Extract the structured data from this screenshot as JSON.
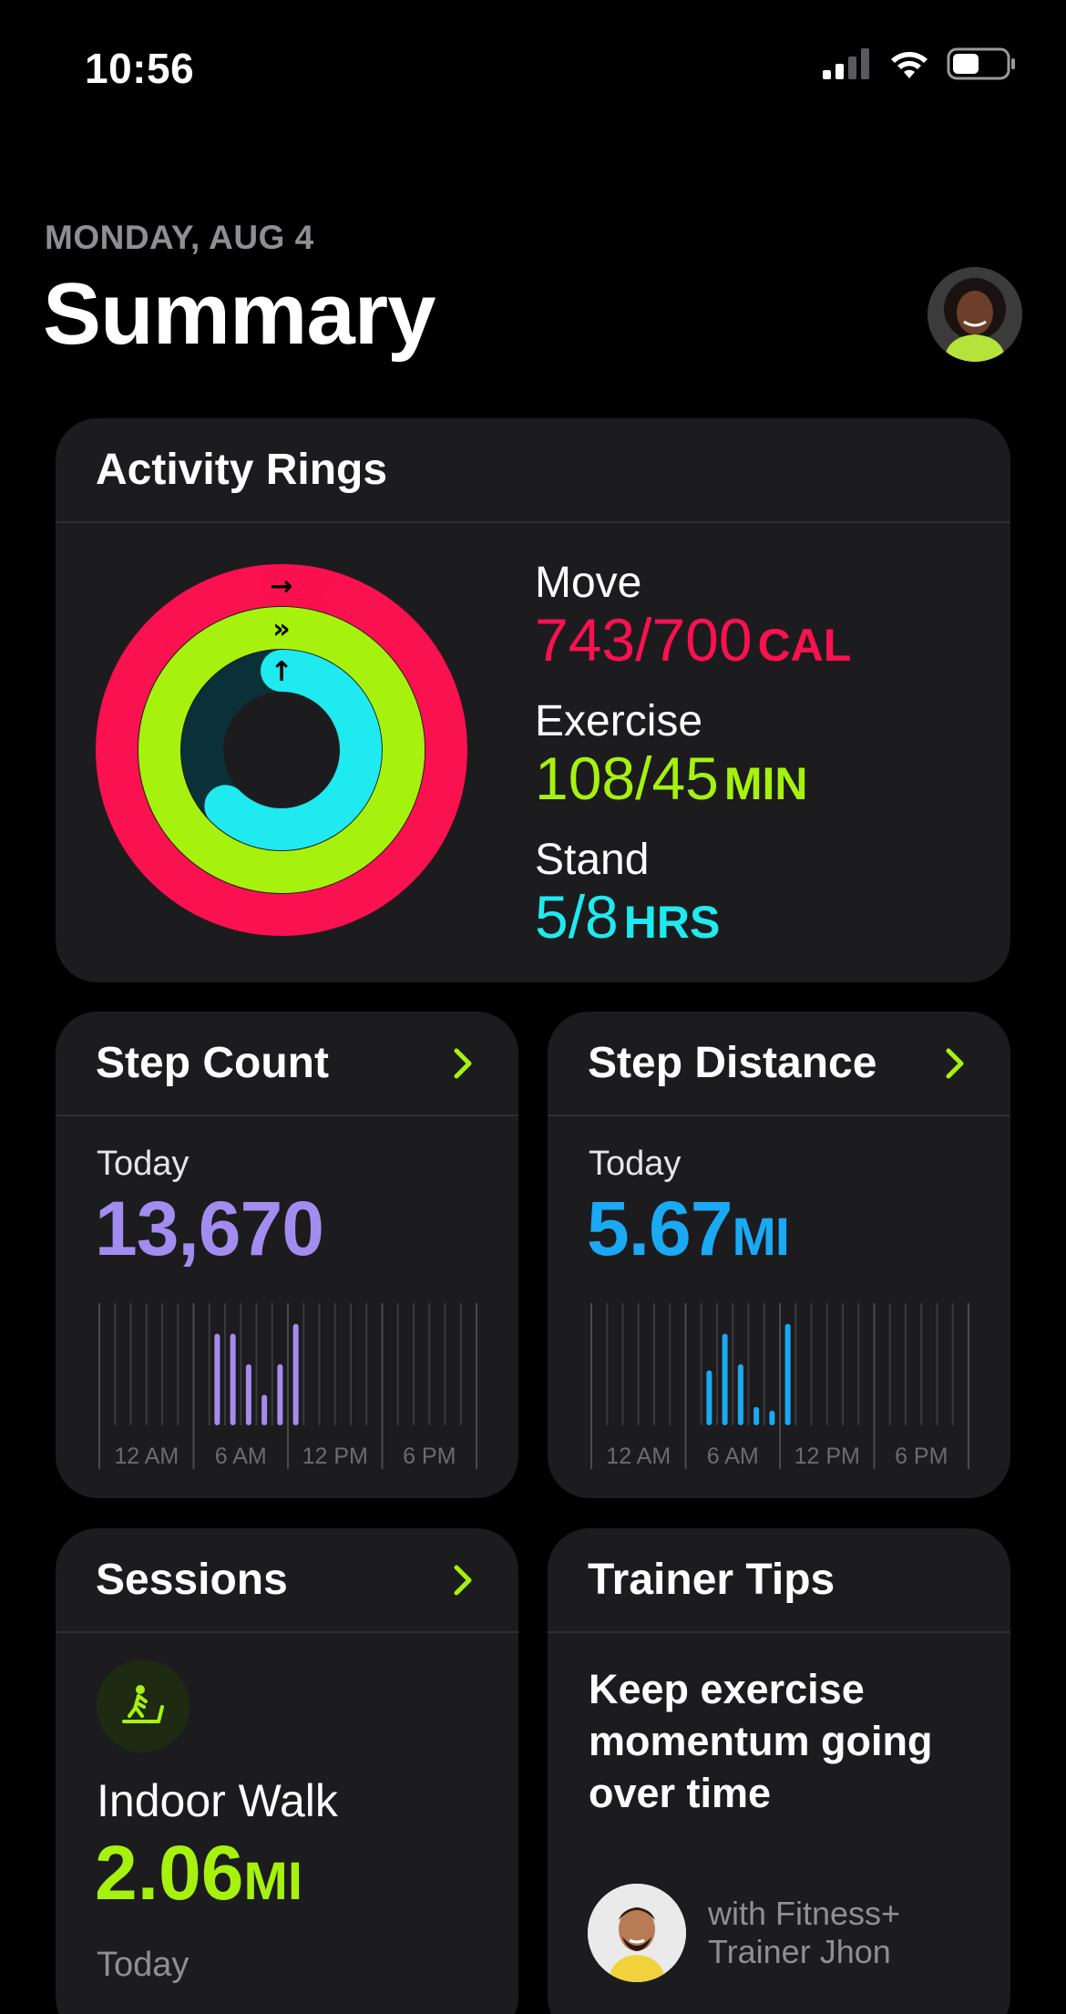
{
  "status": {
    "time": "10:56"
  },
  "header": {
    "date": "MONDAY, AUG 4",
    "title": "Summary"
  },
  "rings_card": {
    "title": "Activity Rings",
    "move": {
      "label": "Move",
      "value": "743/700",
      "unit": "CAL",
      "progress": 1.061
    },
    "exercise": {
      "label": "Exercise",
      "value": "108/45",
      "unit": "MIN",
      "progress": 2.4
    },
    "stand": {
      "label": "Stand",
      "value": "5/8",
      "unit": "HRS",
      "progress": 0.625
    }
  },
  "step_count": {
    "title": "Step Count",
    "period": "Today",
    "value": "13,670",
    "bars": [
      0.75,
      0.75,
      0.5,
      0.25,
      0.5,
      0.83
    ],
    "axis_labels": [
      "12 AM",
      "6 AM",
      "12 PM",
      "6 PM"
    ]
  },
  "step_distance": {
    "title": "Step Distance",
    "period": "Today",
    "value": "5.67",
    "unit": "MI",
    "bars": [
      0.45,
      0.75,
      0.5,
      0.15,
      0.12,
      0.83
    ],
    "axis_labels": [
      "12 AM",
      "6 AM",
      "12 PM",
      "6 PM"
    ]
  },
  "sessions": {
    "title": "Sessions",
    "activity": "Indoor Walk",
    "value": "2.06",
    "unit": "MI",
    "period": "Today"
  },
  "trainer_tips": {
    "title": "Trainer Tips",
    "tip": "Keep exercise momentum going over time",
    "line1": "with Fitness+",
    "line2": "Trainer Jhon"
  },
  "colors": {
    "move": "#fa114f",
    "exercise": "#a6f20e",
    "stand": "#1eeaef",
    "steps": "#a38cf0",
    "distance": "#1aa9f5",
    "accent_chevron": "#a6f20e"
  }
}
